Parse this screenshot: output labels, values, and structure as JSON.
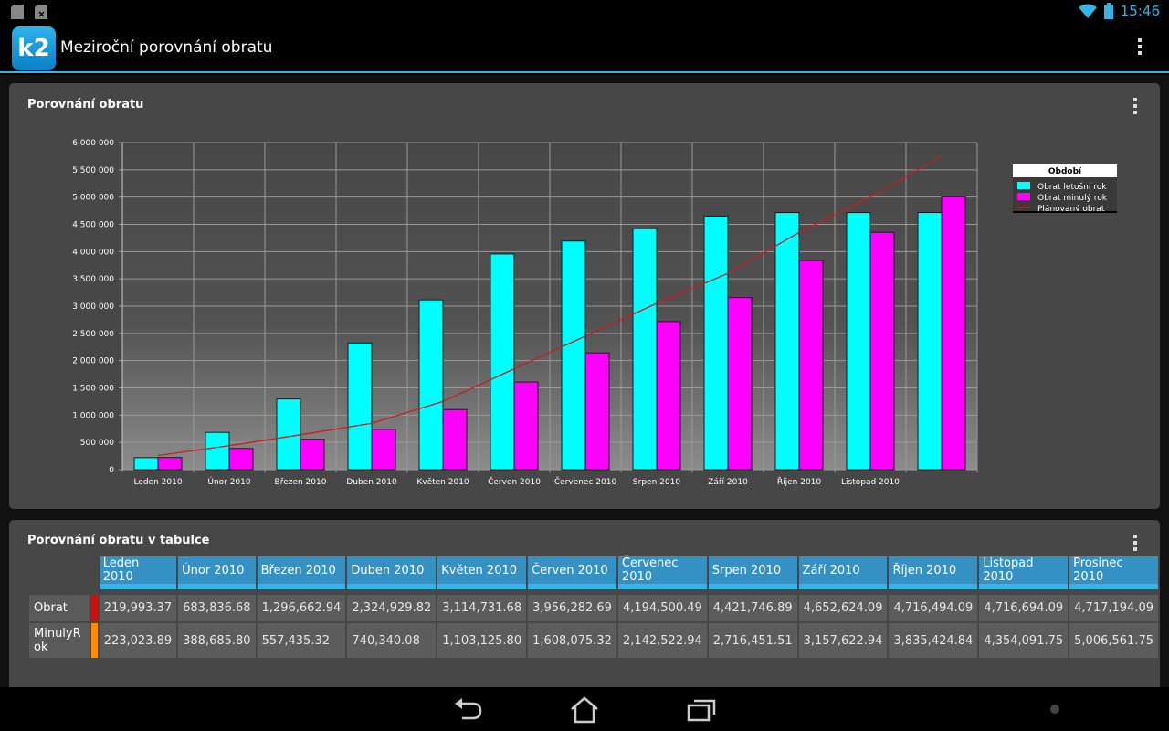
{
  "status_bar": {
    "time": "15:46"
  },
  "app": {
    "logo_text": "k2",
    "title": "Meziroční porovnání obratu"
  },
  "chart_panel": {
    "title": "Porovnání obratu"
  },
  "chart_data": {
    "type": "bar",
    "categories": [
      "Leden 2010",
      "Únor 2010",
      "Březen 2010",
      "Duben 2010",
      "Květen 2010",
      "Červen 2010",
      "Červenec 2010",
      "Srpen 2010",
      "Září 2010",
      "Říjen 2010",
      "Listopad 2010",
      ""
    ],
    "series": [
      {
        "name": "Obrat letošní rok",
        "type": "bar",
        "color": "#00ffff",
        "values": [
          219993.37,
          683836.68,
          1296662.94,
          2324929.82,
          3114731.68,
          3956282.69,
          4194500.49,
          4421746.89,
          4652624.09,
          4716494.09,
          4716694.09,
          4717194.09
        ]
      },
      {
        "name": "Obrat minulý rok",
        "type": "bar",
        "color": "#ff00ff",
        "values": [
          223023.89,
          388685.8,
          557435.32,
          740340.08,
          1103125.8,
          1608075.32,
          2142522.94,
          2716451.51,
          3157622.94,
          3835424.84,
          4354091.75,
          5006561.75
        ]
      },
      {
        "name": "Plánovaný obrat",
        "type": "line",
        "color": "#c81e1e",
        "values": [
          260000,
          440000,
          640000,
          850000,
          1250000,
          1850000,
          2450000,
          3050000,
          3600000,
          4350000,
          5000000,
          5750000
        ]
      }
    ],
    "ylim": [
      0,
      6000000
    ],
    "yticks": [
      0,
      500000,
      1000000,
      1500000,
      2000000,
      2500000,
      3000000,
      3500000,
      4000000,
      4500000,
      5000000,
      5500000,
      6000000
    ],
    "ytick_labels": [
      "0",
      "500 000",
      "1 000 000",
      "1 500 000",
      "2 000 000",
      "2 500 000",
      "3 000 000",
      "3 500 000",
      "4 000 000",
      "4 500 000",
      "5 000 000",
      "5 500 000",
      "6 000 000"
    ],
    "grid": true,
    "legend": {
      "title": "Období",
      "position": "right"
    }
  },
  "table_panel": {
    "title": "Porovnání obratu v tabulce",
    "columns": [
      "Leden 2010",
      "Únor 2010",
      "Březen 2010",
      "Duben 2010",
      "Květen 2010",
      "Červen 2010",
      "Červenec 2010",
      "Srpen 2010",
      "Září 2010",
      "Říjen 2010",
      "Listopad 2010",
      "Prosinec 2010"
    ],
    "rows": [
      {
        "label": "Obrat",
        "marker_color": "#cc1111",
        "values": [
          "219,993.37",
          "683,836.68",
          "1,296,662.94",
          "2,324,929.82",
          "3,114,731.68",
          "3,956,282.69",
          "4,194,500.49",
          "4,421,746.89",
          "4,652,624.09",
          "4,716,494.09",
          "4,716,694.09",
          "4,717,194.09"
        ]
      },
      {
        "label": "MinulyRok",
        "marker_color": "#ff8c00",
        "values": [
          "223,023.89",
          "388,685.80",
          "557,435.32",
          "740,340.08",
          "1,103,125.80",
          "1,608,075.32",
          "2,142,522.94",
          "2,716,451.51",
          "3,157,622.94",
          "3,835,424.84",
          "4,354,091.75",
          "5,006,561.75"
        ]
      }
    ]
  },
  "icons": {
    "status_left": [
      "sd-card-icon",
      "sd-card-removed-icon"
    ],
    "status_right": [
      "wifi-icon",
      "battery-icon"
    ],
    "nav": [
      "back-icon",
      "home-icon",
      "recent-apps-icon",
      "menu-dot-icon"
    ]
  },
  "colors": {
    "accent": "#33b5e5",
    "panel": "#474747",
    "table_header": "#3590c4"
  }
}
